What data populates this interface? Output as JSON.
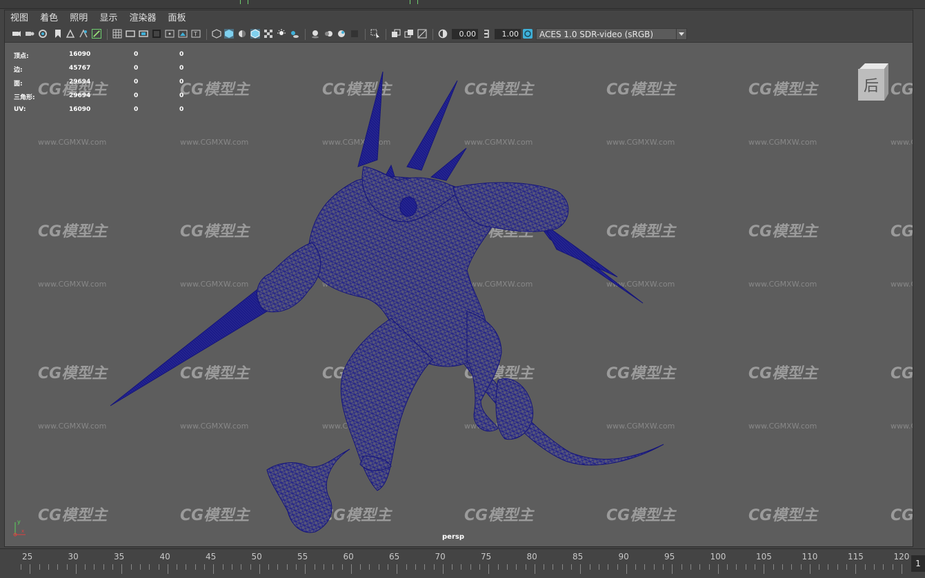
{
  "menus": [
    "视图",
    "着色",
    "照明",
    "显示",
    "渲染器",
    "面板"
  ],
  "toolbar": {
    "exposure": "0.00",
    "gamma": "1.00",
    "color_space": "ACES 1.0 SDR-video (sRGB)"
  },
  "hud": {
    "rows": [
      {
        "label": "顶点:",
        "v1": "16090",
        "v2": "0",
        "v3": "0"
      },
      {
        "label": "边:",
        "v1": "45767",
        "v2": "0",
        "v3": "0"
      },
      {
        "label": "面:",
        "v1": "29694",
        "v2": "0",
        "v3": "0"
      },
      {
        "label": "三角形:",
        "v1": "29694",
        "v2": "0",
        "v3": "0"
      },
      {
        "label": "UV:",
        "v1": "16090",
        "v2": "0",
        "v3": "0"
      }
    ]
  },
  "viewcube_label": "后",
  "camera_label": "persp",
  "watermark": {
    "logo": "CG模型主",
    "url": "www.CGMXW.com"
  },
  "axis": {
    "y": "y",
    "x": "x"
  },
  "timeline": {
    "ticks": [
      "25",
      "30",
      "35",
      "40",
      "45",
      "50",
      "55",
      "60",
      "65",
      "70",
      "75",
      "80",
      "85",
      "90",
      "95",
      "100",
      "105",
      "110",
      "115",
      "120"
    ],
    "current_frame": "1"
  },
  "colors": {
    "wireframe": "#1a1a8c",
    "viewport_bg": "#5d5d5d",
    "accent_icon": "#3fb0d8"
  }
}
